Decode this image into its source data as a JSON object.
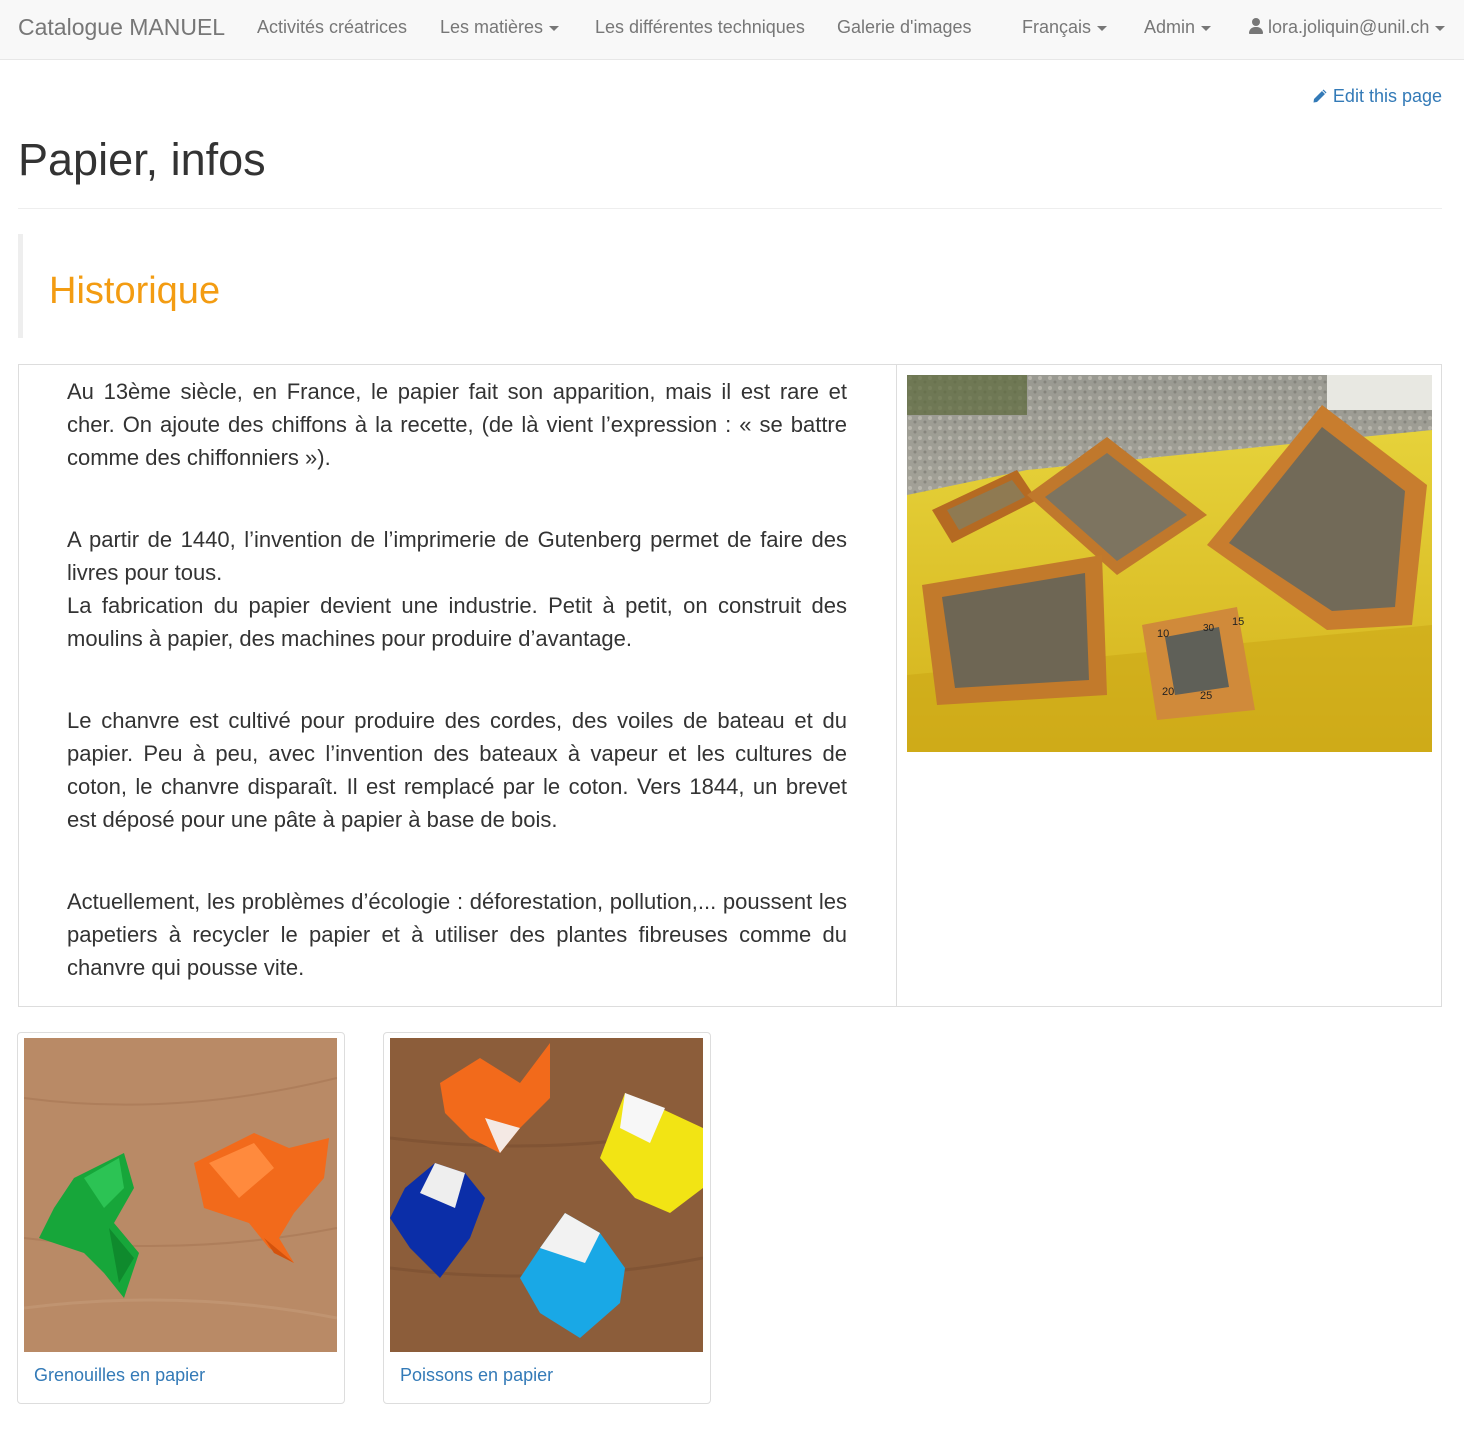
{
  "navbar": {
    "brand": "Catalogue MANUEL",
    "items": [
      {
        "label": "Activités créatrices",
        "dropdown": false
      },
      {
        "label": "Les matières",
        "dropdown": true
      },
      {
        "label": "Les différentes techniques",
        "dropdown": false
      },
      {
        "label": "Galerie d'images",
        "dropdown": false
      }
    ],
    "right": {
      "language": "Français",
      "admin": "Admin",
      "user": "lora.joliquin@unil.ch"
    }
  },
  "edit_link": "Edit this page",
  "page_title": "Papier, infos",
  "section": {
    "title": "Historique",
    "title_color": "#f39c12",
    "paragraphs": [
      [
        "Au 13ème siècle, en France, le papier fait son apparition, mais il est rare et cher. On ajoute des chiffons à la recette, (de là vient l’expression : « se battre comme des chiffonniers »)."
      ],
      [
        "A partir de 1440, l’invention de l’imprimerie de Gutenberg permet de faire des livres pour tous.",
        "La fabrication du papier devient une industrie. Petit à petit, on construit des moulins à papier, des machines pour produire d’avantage."
      ],
      [
        "Le chanvre est cultivé pour produire des cordes, des voiles de bateau et du papier. Peu à peu, avec l’invention des bateaux à vapeur et les cultures de coton, le chanvre disparaît. Il est remplacé par le coton. Vers 1844, un brevet est déposé pour une pâte à papier à base de bois."
      ],
      [
        "Actuellement, les problèmes d’écologie : déforestation, pollution,... poussent les papetiers à recycler le papier et à utiliser des plantes fibreuses comme du chanvre qui pousse vite."
      ]
    ],
    "photo_frame_labels": [
      "10",
      "20",
      "25",
      "15",
      "30"
    ]
  },
  "thumbnails": [
    {
      "caption": "Grenouilles en papier"
    },
    {
      "caption": "Poissons en papier"
    }
  ],
  "colors": {
    "link": "#337ab7",
    "navbar_bg": "#f8f8f8",
    "accent": "#f39c12"
  }
}
